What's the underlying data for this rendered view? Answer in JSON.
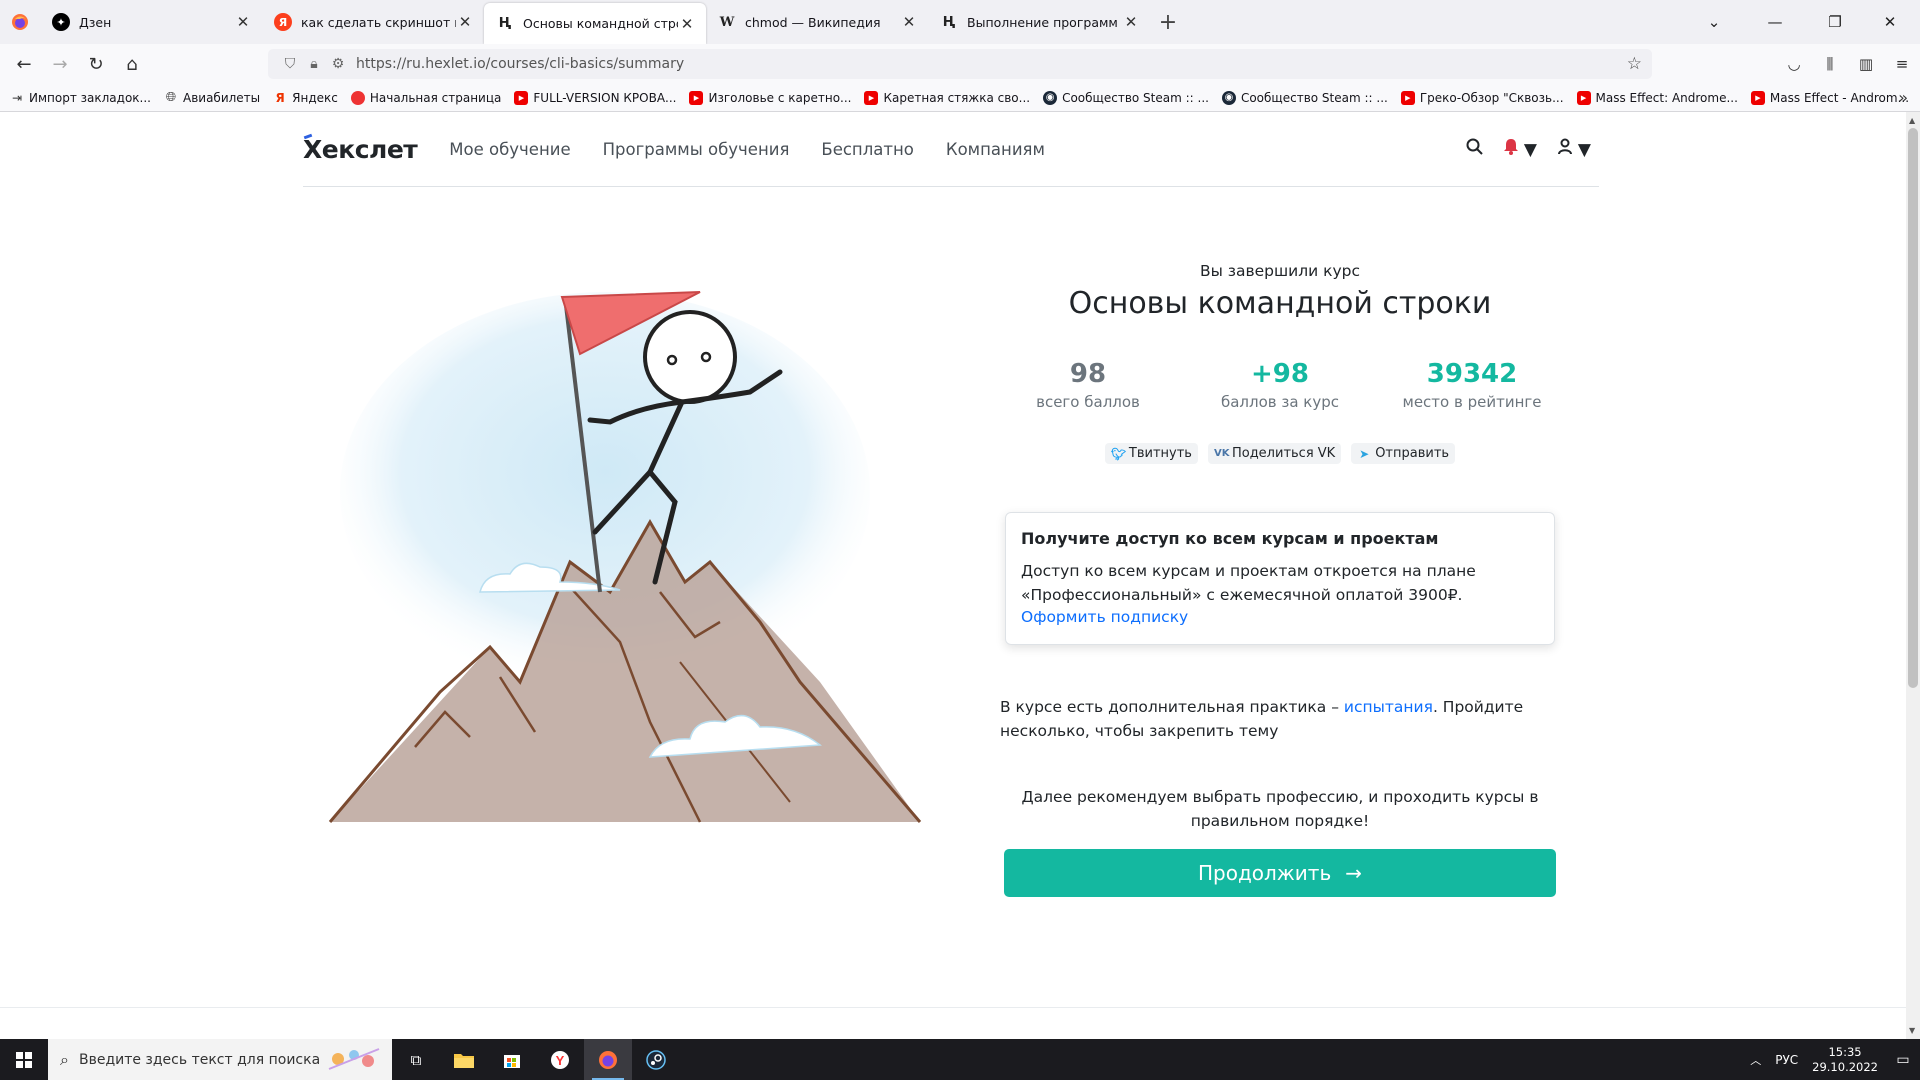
{
  "browser": {
    "tabs": [
      {
        "title": "Дзен",
        "favicon": "dzen-icon"
      },
      {
        "title": "как сделать скриншот на комп",
        "favicon": "yandex-icon"
      },
      {
        "title": "Основы командной строки",
        "favicon": "hexlet-icon",
        "active": true
      },
      {
        "title": "chmod — Википедия",
        "favicon": "wikipedia-icon"
      },
      {
        "title": "Выполнение программ | Осно",
        "favicon": "hexlet-icon"
      }
    ],
    "url": "https://ru.hexlet.io/courses/cli-basics/summary",
    "bookmarks": [
      {
        "label": "Импорт закладок...",
        "icon": "import-icon"
      },
      {
        "label": "Авиабилеты",
        "icon": "globe-icon"
      },
      {
        "label": "Яндекс",
        "icon": "yandex-icon"
      },
      {
        "label": "Начальная страница",
        "icon": "start-page-icon"
      },
      {
        "label": "FULL-VERSION КРОВА...",
        "icon": "youtube-icon"
      },
      {
        "label": "Изголовье с каретно...",
        "icon": "youtube-icon"
      },
      {
        "label": "Каретная стяжка сво...",
        "icon": "youtube-icon"
      },
      {
        "label": "Сообщество Steam :: ...",
        "icon": "steam-icon"
      },
      {
        "label": "Сообщество Steam :: ...",
        "icon": "steam-icon"
      },
      {
        "label": "Греко-Обзор \"Сквозь...",
        "icon": "youtube-icon"
      },
      {
        "label": "Mass Effect: Androme...",
        "icon": "youtube-icon"
      },
      {
        "label": "Mass Effect - Androm...",
        "icon": "youtube-icon"
      }
    ]
  },
  "site": {
    "logo": "Хекслет",
    "nav": [
      "Мое обучение",
      "Программы обучения",
      "Бесплатно",
      "Компаниям"
    ]
  },
  "summary": {
    "done_label": "Вы завершили курс",
    "course_title": "Основы командной строки",
    "stats": [
      {
        "value": "98",
        "label": "всего баллов",
        "color": "#6c757d"
      },
      {
        "value": "+98",
        "label": "баллов за курс",
        "color": "#14b8a0"
      },
      {
        "value": "39342",
        "label": "место в рейтинге",
        "color": "#14b8a0"
      }
    ],
    "share": [
      {
        "label": "Твитнуть",
        "icon": "twitter-icon"
      },
      {
        "label": "Поделиться VK",
        "icon": "vk-icon"
      },
      {
        "label": "Отправить",
        "icon": "telegram-icon"
      }
    ],
    "card": {
      "title": "Получите доступ ко всем курсам и проектам",
      "text": "Доступ ко всем курсам и проектам откроется на плане «Профессиональный» с ежемесячной оплатой 3900₽.",
      "link": "Оформить подписку"
    },
    "practice": {
      "before": "В курсе есть дополнительная практика – ",
      "link": "испытания",
      "after": ". Пройдите несколько, чтобы закрепить тему"
    },
    "recommend": "Далее рекомендуем выбрать профессию, и проходить курсы в правильном порядке!",
    "continue_label": "Продолжить"
  },
  "taskbar": {
    "search_placeholder": "Введите здесь текст для поиска",
    "lang": "РУС",
    "time": "15:35",
    "date": "29.10.2022"
  },
  "colors": {
    "accent": "#14b8a0",
    "link": "#0d6efd"
  }
}
